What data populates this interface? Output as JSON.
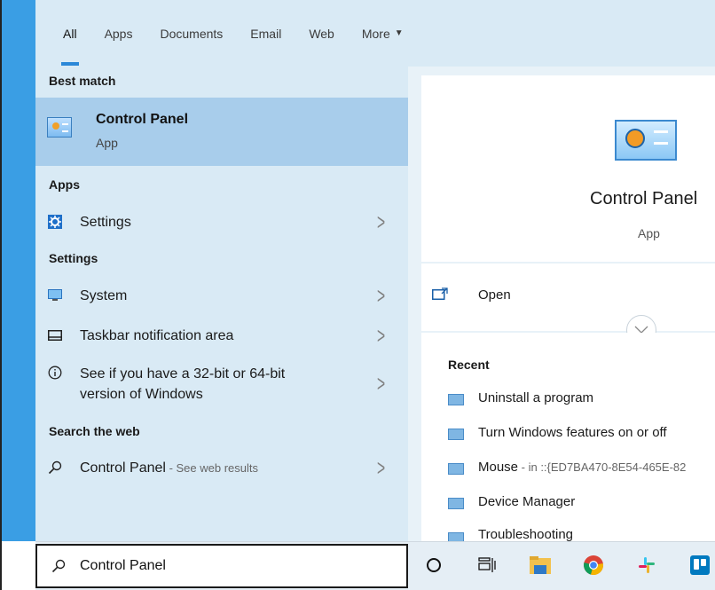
{
  "tabs": [
    {
      "label": "All"
    },
    {
      "label": "Apps"
    },
    {
      "label": "Documents"
    },
    {
      "label": "Email"
    },
    {
      "label": "Web"
    },
    {
      "label": "More"
    }
  ],
  "left": {
    "best_match_header": "Best match",
    "best_match": {
      "title": "Control Panel",
      "subtitle": "App",
      "icon": "control-panel-icon"
    },
    "apps_header": "Apps",
    "apps": [
      {
        "label": "Settings",
        "icon": "gear-icon"
      }
    ],
    "settings_header": "Settings",
    "settings": [
      {
        "label": "System",
        "icon": "monitor-icon"
      },
      {
        "label": "Taskbar notification area",
        "icon": "taskbar-icon"
      },
      {
        "label_line1": "See if you have a 32-bit or 64-bit",
        "label_line2": "version of Windows",
        "icon": "info-icon"
      }
    ],
    "web_header": "Search the web",
    "web": {
      "label": "Control Panel",
      "sub": " - See web results",
      "icon": "search-icon"
    }
  },
  "right": {
    "title": "Control Panel",
    "subtitle": "App",
    "open_label": "Open",
    "recent_header": "Recent",
    "recent": [
      {
        "label": "Uninstall a program"
      },
      {
        "label": "Turn Windows features on or off"
      },
      {
        "label": "Mouse",
        "sub": " - in ::{ED7BA470-8E54-465E-82"
      },
      {
        "label": "Device Manager"
      },
      {
        "label": "Troubleshooting"
      }
    ]
  },
  "search": {
    "value": "Control Panel"
  },
  "colors": {
    "accent": "#3a9ee4",
    "pane": "#d9eaf5",
    "selected": "#a8cdeb"
  }
}
